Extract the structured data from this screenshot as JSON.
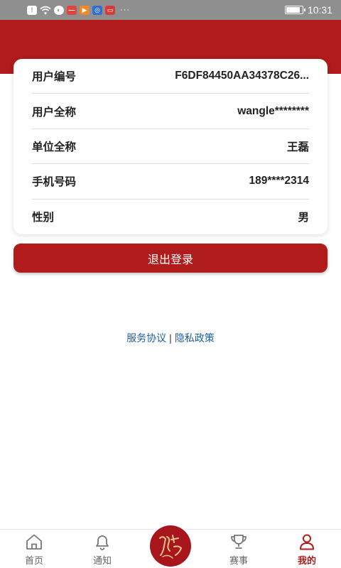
{
  "status_bar": {
    "time": "10:31",
    "battery_level": 0.9,
    "icons": [
      "alert-icon",
      "wifi-icon",
      "vpn-icon",
      "app-icon-red",
      "app-icon-orange",
      "app-icon-blue",
      "app-icon-book"
    ],
    "more": "···"
  },
  "profile": {
    "rows": [
      {
        "label": "用户编号",
        "value": "F6DF84450AA34378C26..."
      },
      {
        "label": "用户全称",
        "value": "wangle********"
      },
      {
        "label": "单位全称",
        "value": "王磊"
      },
      {
        "label": "手机号码",
        "value": "189****2314"
      },
      {
        "label": "性别",
        "value": "男"
      }
    ]
  },
  "logout_label": "退出登录",
  "links": {
    "service": "服务协议",
    "separator": "|",
    "privacy": "隐私政策"
  },
  "tabbar": {
    "items": [
      {
        "label": "首页",
        "icon": "home-icon"
      },
      {
        "label": "通知",
        "icon": "bell-icon"
      },
      {
        "label": "赛事",
        "icon": "trophy-icon"
      },
      {
        "label": "我的",
        "icon": "user-icon"
      }
    ],
    "center_icon": "calligraphy-logo-icon",
    "active_index": 3
  },
  "colors": {
    "brand_red": "#b01b1b",
    "link_blue": "#1c5fa8",
    "status_bar_gray": "#8f8f8f"
  }
}
